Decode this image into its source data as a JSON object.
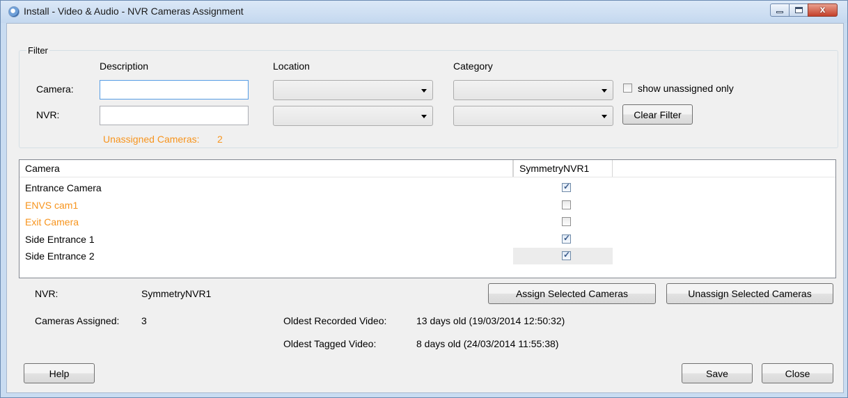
{
  "window": {
    "title": "Install - Video & Audio - NVR Cameras Assignment",
    "close_glyph": "x"
  },
  "filter": {
    "legend": "Filter",
    "headers": {
      "description": "Description",
      "location": "Location",
      "category": "Category"
    },
    "camera_label": "Camera:",
    "nvr_label": "NVR:",
    "camera_description_value": "",
    "nvr_description_value": "",
    "camera_location_value": "",
    "camera_category_value": "",
    "nvr_location_value": "",
    "nvr_category_value": "",
    "show_unassigned_label": "show unassigned only",
    "show_unassigned_checked": false,
    "clear_filter_label": "Clear Filter",
    "unassigned_label": "Unassigned Cameras:",
    "unassigned_count": "2",
    "unassigned_color": "#f7941d"
  },
  "grid": {
    "columns": [
      "Camera",
      "SymmetryNVR1"
    ],
    "rows": [
      {
        "name": "Entrance Camera",
        "assigned": true,
        "unassigned_highlight": false
      },
      {
        "name": "ENVS cam1",
        "assigned": false,
        "unassigned_highlight": true
      },
      {
        "name": "Exit Camera",
        "assigned": false,
        "unassigned_highlight": true
      },
      {
        "name": "Side Entrance 1",
        "assigned": true,
        "unassigned_highlight": false
      },
      {
        "name": "Side Entrance 2",
        "assigned": true,
        "unassigned_highlight": false
      }
    ]
  },
  "details": {
    "nvr_label": "NVR:",
    "nvr_value": "SymmetryNVR1",
    "cameras_assigned_label": "Cameras Assigned:",
    "cameras_assigned_value": "3",
    "oldest_recorded_label": "Oldest Recorded Video:",
    "oldest_recorded_value": "13 days old (19/03/2014 12:50:32)",
    "oldest_tagged_label": "Oldest Tagged Video:",
    "oldest_tagged_value": "8 days old (24/03/2014 11:55:38)",
    "assign_button": "Assign Selected Cameras",
    "unassign_button": "Unassign Selected Cameras"
  },
  "footer": {
    "help_button": "Help",
    "save_button": "Save",
    "close_button": "Close"
  }
}
